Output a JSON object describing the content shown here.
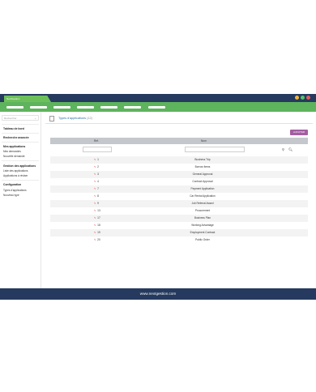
{
  "window": {
    "tab_label": "NextGestion",
    "dots": [
      "#f2b63c",
      "#56c36b",
      "#e25c5c"
    ]
  },
  "navbar": {
    "item_count": 7
  },
  "sidebar": {
    "search_placeholder": "Rechercher",
    "sections": [
      {
        "heading": "Tableau de bord",
        "links": []
      },
      {
        "heading": "Recherche avancée",
        "links": []
      },
      {
        "heading": "Mes applications",
        "links": [
          "Mes demandes",
          "Nouvelle demande"
        ]
      },
      {
        "heading": "Gestion des applications",
        "links": [
          "Liste des applications",
          "Applications à réviser"
        ]
      },
      {
        "heading": "Configuration",
        "links": [
          "Types d'applications",
          "Nouveau type"
        ]
      }
    ]
  },
  "main": {
    "title": "Types d'applications",
    "count": "(12)",
    "add_button": "AJOUTER",
    "columns": {
      "ref": "Ref.",
      "name": "Nom"
    },
    "filter_icons": [
      "search-icon",
      "zoom-icon"
    ],
    "rows": [
      {
        "ref": "1",
        "name": "Business Trip"
      },
      {
        "ref": "2",
        "name": "Borrow Items"
      },
      {
        "ref": "3",
        "name": "General Approval"
      },
      {
        "ref": "4",
        "name": "Contract Approval"
      },
      {
        "ref": "7",
        "name": "Payment Application"
      },
      {
        "ref": "8",
        "name": "Car Rental Application"
      },
      {
        "ref": "9",
        "name": "Job Referral Award"
      },
      {
        "ref": "13",
        "name": "Procurement"
      },
      {
        "ref": "17",
        "name": "Business Plan"
      },
      {
        "ref": "18",
        "name": "Working Advantage"
      },
      {
        "ref": "19",
        "name": "Employment Contract"
      },
      {
        "ref": "20",
        "name": "Public Order"
      }
    ]
  },
  "footer": {
    "text": "www.nextgestion.com"
  },
  "colors": {
    "header_navy": "#253a5e",
    "nav_green": "#5eb35d",
    "accent_purple": "#a35ea1",
    "link_blue": "#2e6ea8"
  }
}
